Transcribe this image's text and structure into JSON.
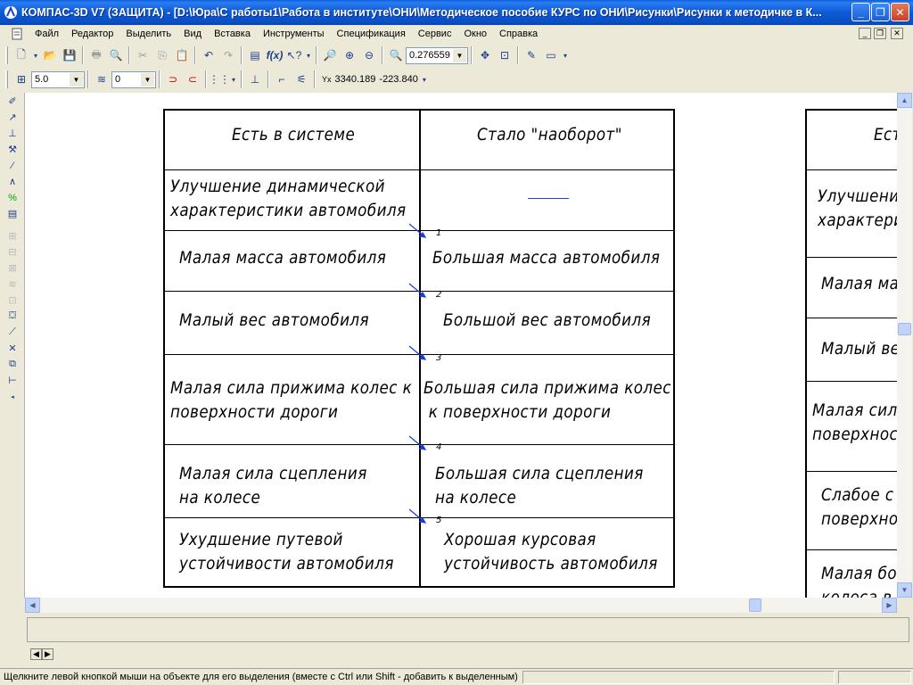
{
  "window": {
    "title": "КОМПАС-3D V7 (ЗАЩИТА) - [D:\\Юра\\С работы1\\Работа в институте\\ОНИ\\Методическое пособие КУРС по ОНИ\\Рисунки\\Рисунки к методичке в К...",
    "minimize": "_",
    "maximize": "❐",
    "close": "✕"
  },
  "menu": [
    "Файл",
    "Редактор",
    "Выделить",
    "Вид",
    "Вставка",
    "Инструменты",
    "Спецификация",
    "Сервис",
    "Окно",
    "Справка"
  ],
  "mdi_controls": [
    "_",
    "❐",
    "✕"
  ],
  "toolbar_main": {
    "zoom_value": "0.276559"
  },
  "toolbar_props": {
    "step_value": "5.0",
    "layer_value": "0",
    "coord_x": "3340.189",
    "coord_y": "-223.840"
  },
  "table": {
    "header_left": "Есть в системе",
    "header_right": "Стало \"наоборот\"",
    "rows": [
      {
        "left": [
          "Улучшение динамической",
          "характеристики автомобиля"
        ],
        "right": [],
        "leader": ""
      },
      {
        "left": [
          "Малая масса автомобиля"
        ],
        "right": [
          "Большая масса автомобиля"
        ],
        "leader": "1"
      },
      {
        "left": [
          "Малый вес автомобиля"
        ],
        "right": [
          "Большой вес автомобиля"
        ],
        "leader": "2"
      },
      {
        "left": [
          "Малая сила прижима колес к",
          "поверхности дороги"
        ],
        "right": [
          "Большая сила прижима колес",
          " к поверхности дороги"
        ],
        "leader": "3"
      },
      {
        "left": [
          "Малая сила сцепления",
          "на колесе"
        ],
        "right": [
          "Большая сила сцепления",
          "на колесе"
        ],
        "leader": "4"
      },
      {
        "left": [
          "Ухудшение путевой",
          "устойчивости автомобиля"
        ],
        "right": [
          "Хорошая курсовая",
          "устойчивость автомобиля"
        ],
        "leader": "5"
      }
    ]
  },
  "table2": {
    "cells": [
      "Ест",
      "Улучшени",
      "характеристи",
      "Малая ма",
      "Малый ве",
      "Малая сил",
      "поверхнос",
      "Слабое с",
      "поверхно",
      "Малая бо",
      "колеса в"
    ]
  },
  "status": {
    "hint": "Щелкните левой кнопкой мыши на объекте для его выделения (вместе с Ctrl или Shift - добавить к выделенным)"
  },
  "colors": {
    "titlebar": "#0a5fdc",
    "chrome": "#ece9d8",
    "canvas": "#ffffff",
    "link_line": "#1a3fd6"
  }
}
